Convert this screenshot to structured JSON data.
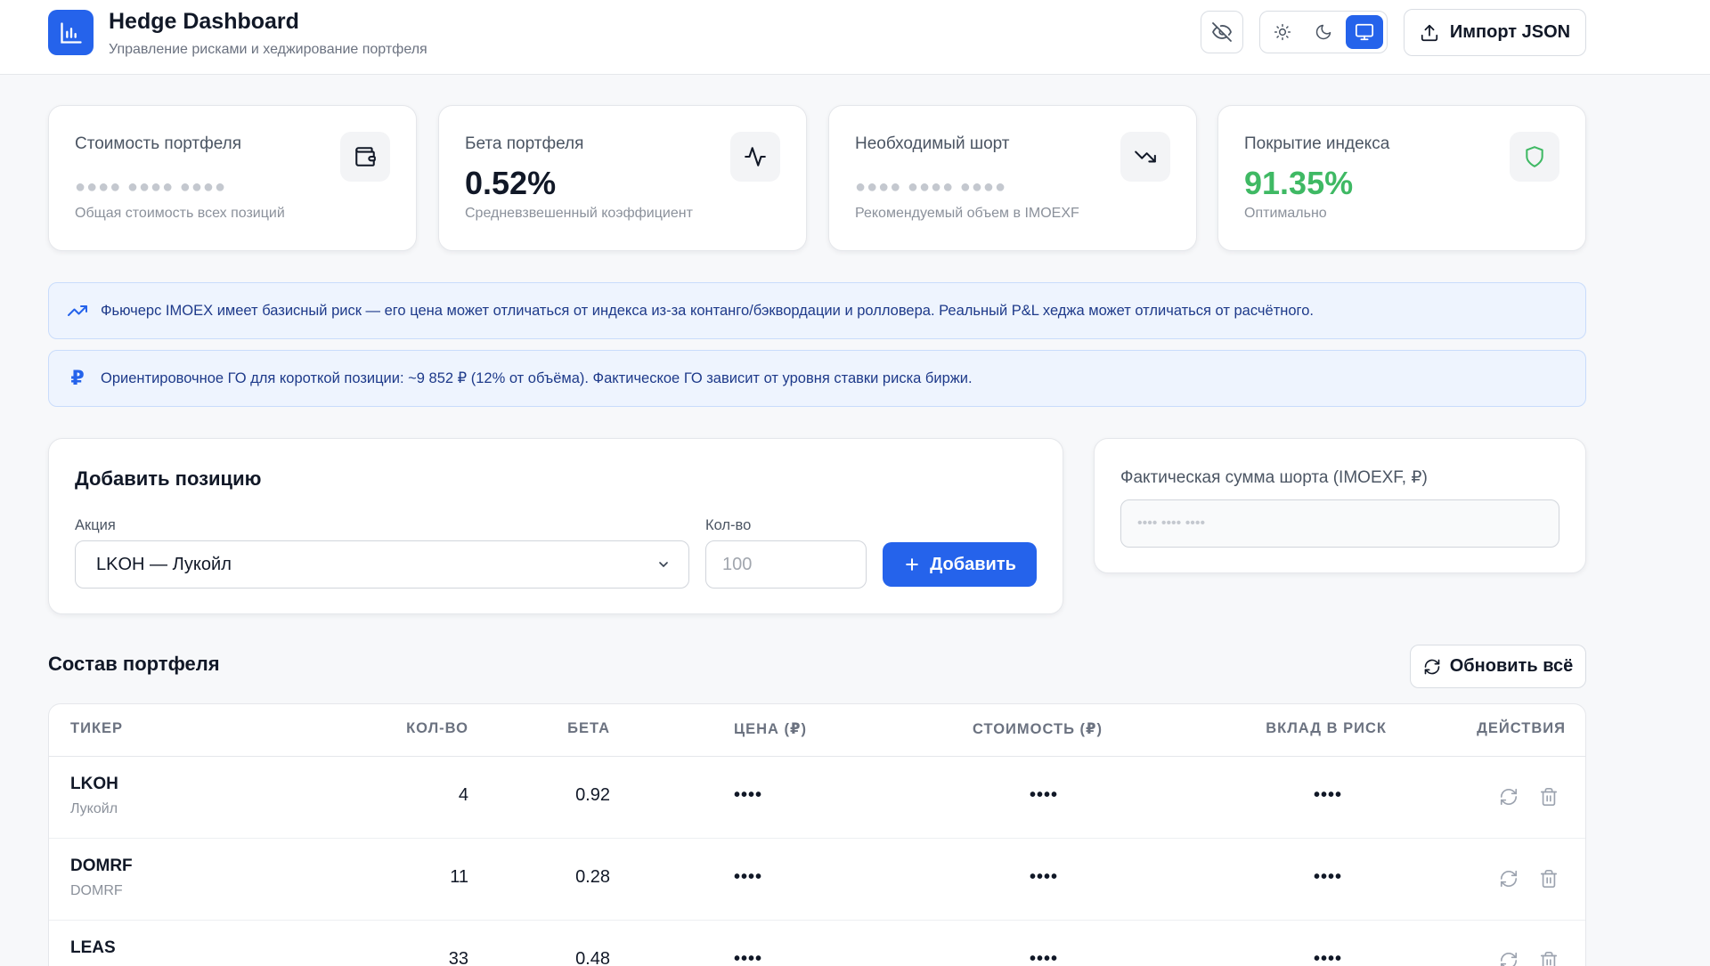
{
  "header": {
    "title": "Hedge Dashboard",
    "subtitle": "Управление рисками и хеджирование портфеля",
    "import_label": "Импорт JSON",
    "theme_active": "system"
  },
  "stats": [
    {
      "label": "Стоимость портфеля",
      "value": "",
      "masked": "●●●● ●●●● ●●●●",
      "sub": "Общая стоимость всех позиций",
      "icon": "wallet-icon"
    },
    {
      "label": "Бета портфеля",
      "value": "0.52%",
      "masked": "",
      "sub": "Средневзвешенный коэффициент",
      "icon": "activity-icon"
    },
    {
      "label": "Необходимый шорт",
      "value": "",
      "masked": "●●●● ●●●● ●●●●",
      "sub": "Рекомендуемый объем в IMOEXF",
      "icon": "trending-down-icon"
    },
    {
      "label": "Покрытие индекса",
      "value": "91.35%",
      "masked": "",
      "sub": "Оптимально",
      "icon": "shield-icon"
    }
  ],
  "notes": [
    {
      "icon": "trending-up-icon",
      "text": "Фьючерс IMOEX имеет базисный риск — его цена может отличаться от индекса из-за контанго/бэквордации и ролловера. Реальный P&L хеджа может отличаться от расчётного."
    },
    {
      "icon": "ruble-icon",
      "glyph": "₽",
      "text": "Ориентировочное ГО для короткой позиции: ~9 852 ₽ (12% от объёма). Фактическое ГО зависит от уровня ставки риска биржи."
    }
  ],
  "add_position": {
    "title": "Добавить позицию",
    "stock_label": "Акция",
    "stock_selected": "LKOH — Лукойл",
    "qty_label": "Кол-во",
    "qty_placeholder": "100",
    "add_label": "Добавить"
  },
  "short_sum": {
    "label": "Фактическая сумма шорта (IMOEXF, ₽)",
    "placeholder": "•••• •••• ••••"
  },
  "portfolio": {
    "title": "Состав портфеля",
    "refresh_label": "Обновить всё",
    "columns": [
      "ТИКЕР",
      "КОЛ-ВО",
      "БЕТА",
      "ЦЕНА (₽)",
      "СТОИМОСТЬ (₽)",
      "ВКЛАД В РИСК",
      "ДЕЙСТВИЯ"
    ],
    "rows": [
      {
        "ticker": "LKOH",
        "name": "Лукойл",
        "qty": "4",
        "beta": "0.92",
        "price": "••••",
        "value": "••••",
        "risk": "••••"
      },
      {
        "ticker": "DOMRF",
        "name": "DOMRF",
        "qty": "11",
        "beta": "0.28",
        "price": "••••",
        "value": "••••",
        "risk": "••••"
      },
      {
        "ticker": "LEAS",
        "name": "",
        "qty": "33",
        "beta": "0.48",
        "price": "••••",
        "value": "••••",
        "risk": "••••"
      }
    ]
  },
  "colors": {
    "accent": "#2563eb",
    "positive": "#3fb964",
    "note_bg": "#eef4fe",
    "note_text": "#1e3a8a"
  }
}
